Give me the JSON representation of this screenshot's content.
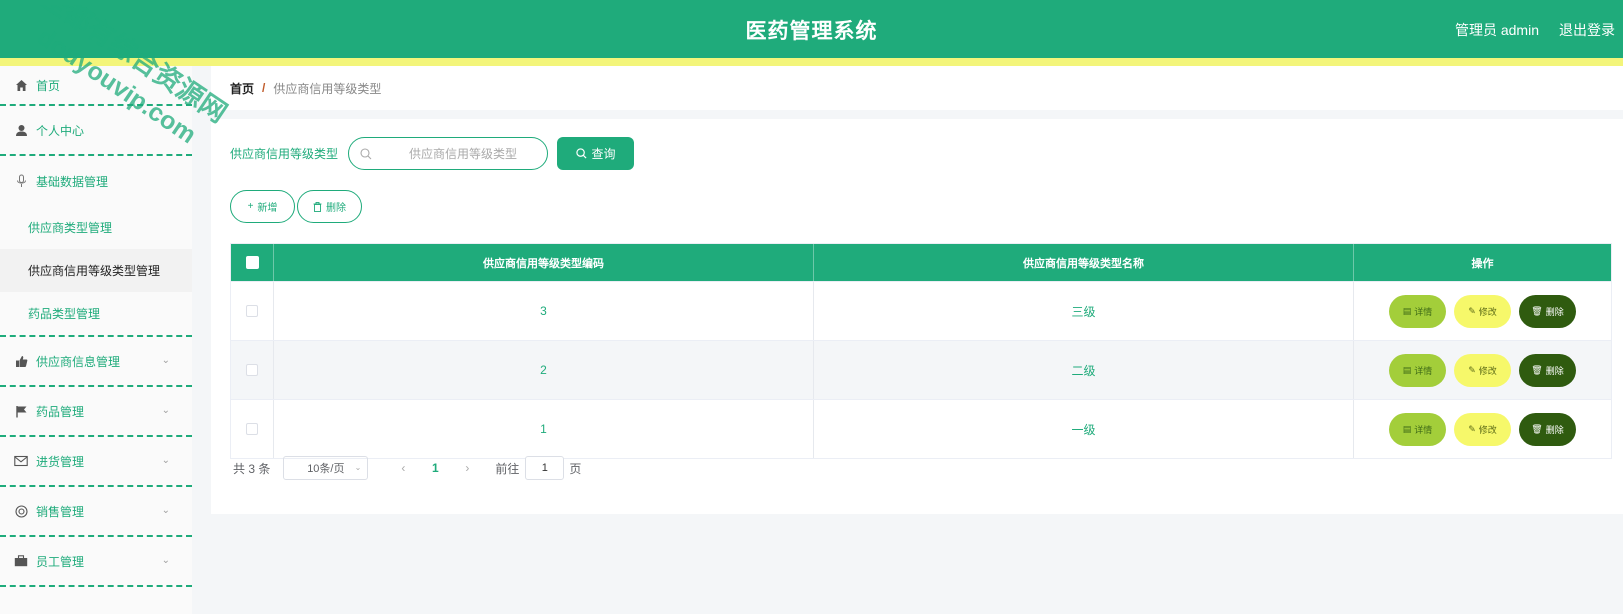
{
  "header": {
    "title": "医药管理系统",
    "user": "管理员 admin",
    "logout": "退出登录"
  },
  "sidebar": {
    "home": "首页",
    "items": [
      {
        "label": "个人中心"
      },
      {
        "label": "基础数据管理",
        "children": [
          "供应商类型管理",
          "供应商信用等级类型管理",
          "药品类型管理"
        ]
      },
      {
        "label": "供应商信息管理"
      },
      {
        "label": "药品管理"
      },
      {
        "label": "进货管理"
      },
      {
        "label": "销售管理"
      },
      {
        "label": "员工管理"
      }
    ]
  },
  "breadcrumb": {
    "home": "首页",
    "sep": "/",
    "current": "供应商信用等级类型"
  },
  "search": {
    "label": "供应商信用等级类型",
    "placeholder": "供应商信用等级类型",
    "button": "查询"
  },
  "actions": {
    "add": "新增",
    "delete": "删除"
  },
  "table": {
    "columns": [
      "供应商信用等级类型编码",
      "供应商信用等级类型名称",
      "操作"
    ],
    "rows": [
      {
        "code": "3",
        "name": "三级"
      },
      {
        "code": "2",
        "name": "二级"
      },
      {
        "code": "1",
        "name": "一级"
      }
    ],
    "ops": {
      "detail": "详情",
      "edit": "修改",
      "delete": "删除"
    }
  },
  "pagination": {
    "total": "共 3 条",
    "page_size": "10条/页",
    "current": "1",
    "goto": "前往",
    "goto_value": "1",
    "page_suffix": "页"
  },
  "watermark": {
    "line1": "全都有综合资源网",
    "line2": "douyouvip.com"
  },
  "colors": {
    "primary": "#1fab7b",
    "stripe": "#f3f57a",
    "detail": "#a3ce3a",
    "edit": "#f6f86a",
    "danger": "#2f5b0f"
  }
}
